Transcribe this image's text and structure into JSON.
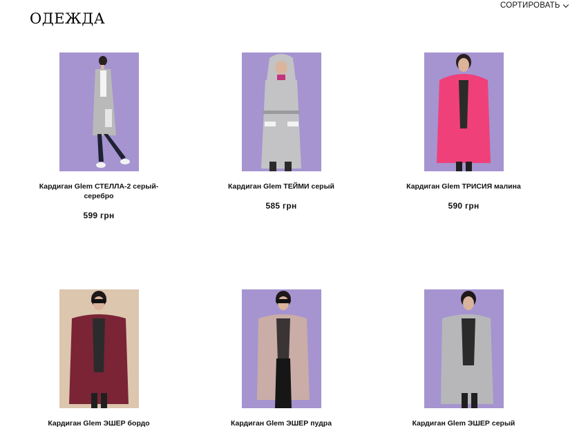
{
  "header": {
    "title": "ОДЕЖДА",
    "sort_label": "СОРТИРОВАТЬ",
    "sort_icon": "chevron-down-icon"
  },
  "products": [
    {
      "name": "Кардиган Glem СТЕЛЛА-2 серый-серебро",
      "price": "599 грн",
      "background": "#a594d0",
      "garment_color": "#b9b9b9"
    },
    {
      "name": "Кардиган Glem ТЕЙМИ серый",
      "price": "585 грн",
      "background": "#a594d0",
      "garment_color": "#c3c3c6"
    },
    {
      "name": "Кардиган Glem ТРИСИЯ малина",
      "price": "590 грн",
      "background": "#a594d0",
      "garment_color": "#f0407a"
    },
    {
      "name": "Кардиган Glem ЭШЕР бордо",
      "price": "",
      "background": "#dcc6ae",
      "garment_color": "#7a2436"
    },
    {
      "name": "Кардиган Glem ЭШЕР пудра",
      "price": "",
      "background": "#a594d0",
      "garment_color": "#c9ada6"
    },
    {
      "name": "Кардиган Glem ЭШЕР серый",
      "price": "",
      "background": "#a594d0",
      "garment_color": "#b7b7ba"
    }
  ]
}
